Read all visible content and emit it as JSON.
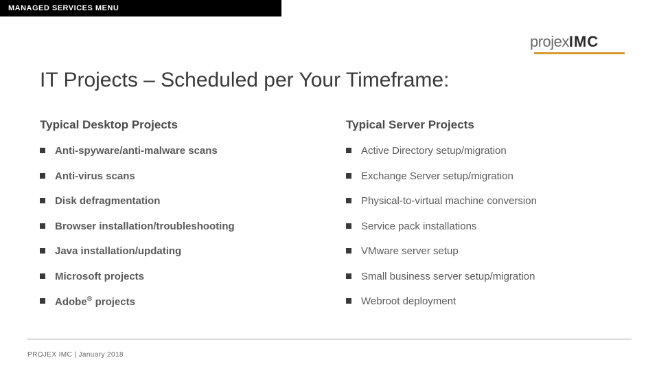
{
  "header": {
    "menu_label": "MANAGED SERVICES MENU",
    "logo_part1": "projex",
    "logo_part2": "IMC"
  },
  "title": "IT Projects – Scheduled per Your Timeframe:",
  "columns": {
    "left": {
      "heading": "Typical Desktop Projects",
      "items": [
        "Anti-spyware/anti-malware scans",
        "Anti-virus scans",
        "Disk defragmentation",
        "Browser installation/troubleshooting",
        "Java installation/updating",
        "Microsoft projects",
        "Adobe® projects"
      ]
    },
    "right": {
      "heading": "Typical Server Projects",
      "items": [
        "Active Directory setup/migration",
        "Exchange Server setup/migration",
        "Physical-to-virtual machine conversion",
        "Service pack installations",
        "VMware server setup",
        "Small business server setup/migration",
        "Webroot deployment"
      ]
    }
  },
  "footer": "PROJEX IMC  |  January 2018"
}
